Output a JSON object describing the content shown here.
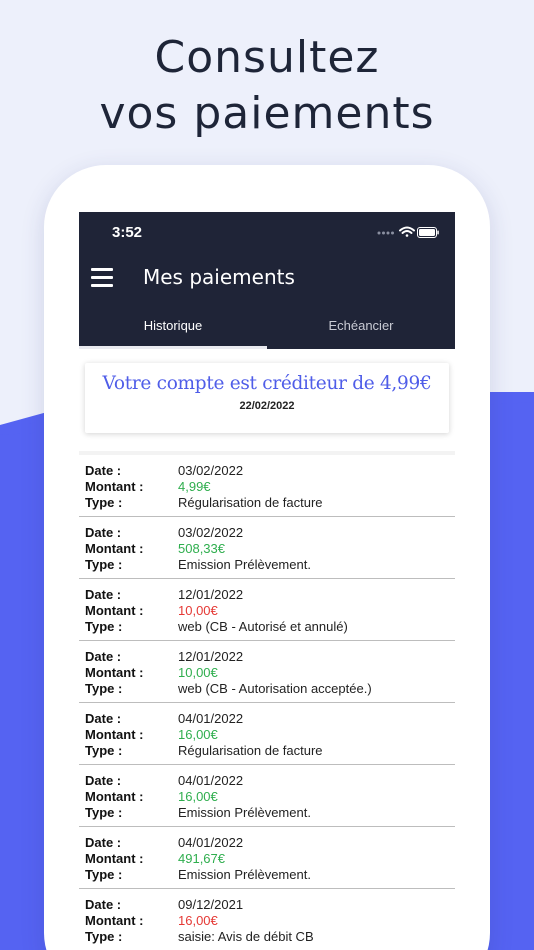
{
  "headline": {
    "line1": "Consultez",
    "line2": "vos paiements"
  },
  "colors": {
    "background_light": "#edf0fb",
    "background_blue": "#5563f2",
    "appbar": "#1f2437",
    "accent": "#4f5de8",
    "positive": "#2fae4e",
    "negative": "#e53935"
  },
  "status_bar": {
    "time": "3:52",
    "icons": [
      "signal-dots-icon",
      "wifi-icon",
      "battery-icon"
    ]
  },
  "app": {
    "title": "Mes paiements",
    "menu_icon": "hamburger-menu-icon",
    "tabs": [
      {
        "label": "Historique",
        "active": true
      },
      {
        "label": "Echéancier",
        "active": false
      }
    ]
  },
  "balance": {
    "text": "Votre compte est créditeur de 4,99€",
    "date": "22/02/2022"
  },
  "labels": {
    "date": "Date :",
    "amount": "Montant :",
    "type": "Type :"
  },
  "payments": [
    {
      "date": "03/02/2022",
      "amount": "4,99€",
      "status": "positive",
      "type": "Régularisation de facture"
    },
    {
      "date": "03/02/2022",
      "amount": "508,33€",
      "status": "positive",
      "type": "Emission Prélèvement."
    },
    {
      "date": "12/01/2022",
      "amount": "10,00€",
      "status": "negative",
      "type": "web (CB - Autorisé et annulé)"
    },
    {
      "date": "12/01/2022",
      "amount": "10,00€",
      "status": "positive",
      "type": "web (CB - Autorisation acceptée.)"
    },
    {
      "date": "04/01/2022",
      "amount": "16,00€",
      "status": "positive",
      "type": "Régularisation de facture"
    },
    {
      "date": "04/01/2022",
      "amount": "16,00€",
      "status": "positive",
      "type": "Emission Prélèvement."
    },
    {
      "date": "04/01/2022",
      "amount": "491,67€",
      "status": "positive",
      "type": "Emission Prélèvement."
    },
    {
      "date": "09/12/2021",
      "amount": "16,00€",
      "status": "negative",
      "type": "saisie: Avis de débit CB"
    }
  ]
}
